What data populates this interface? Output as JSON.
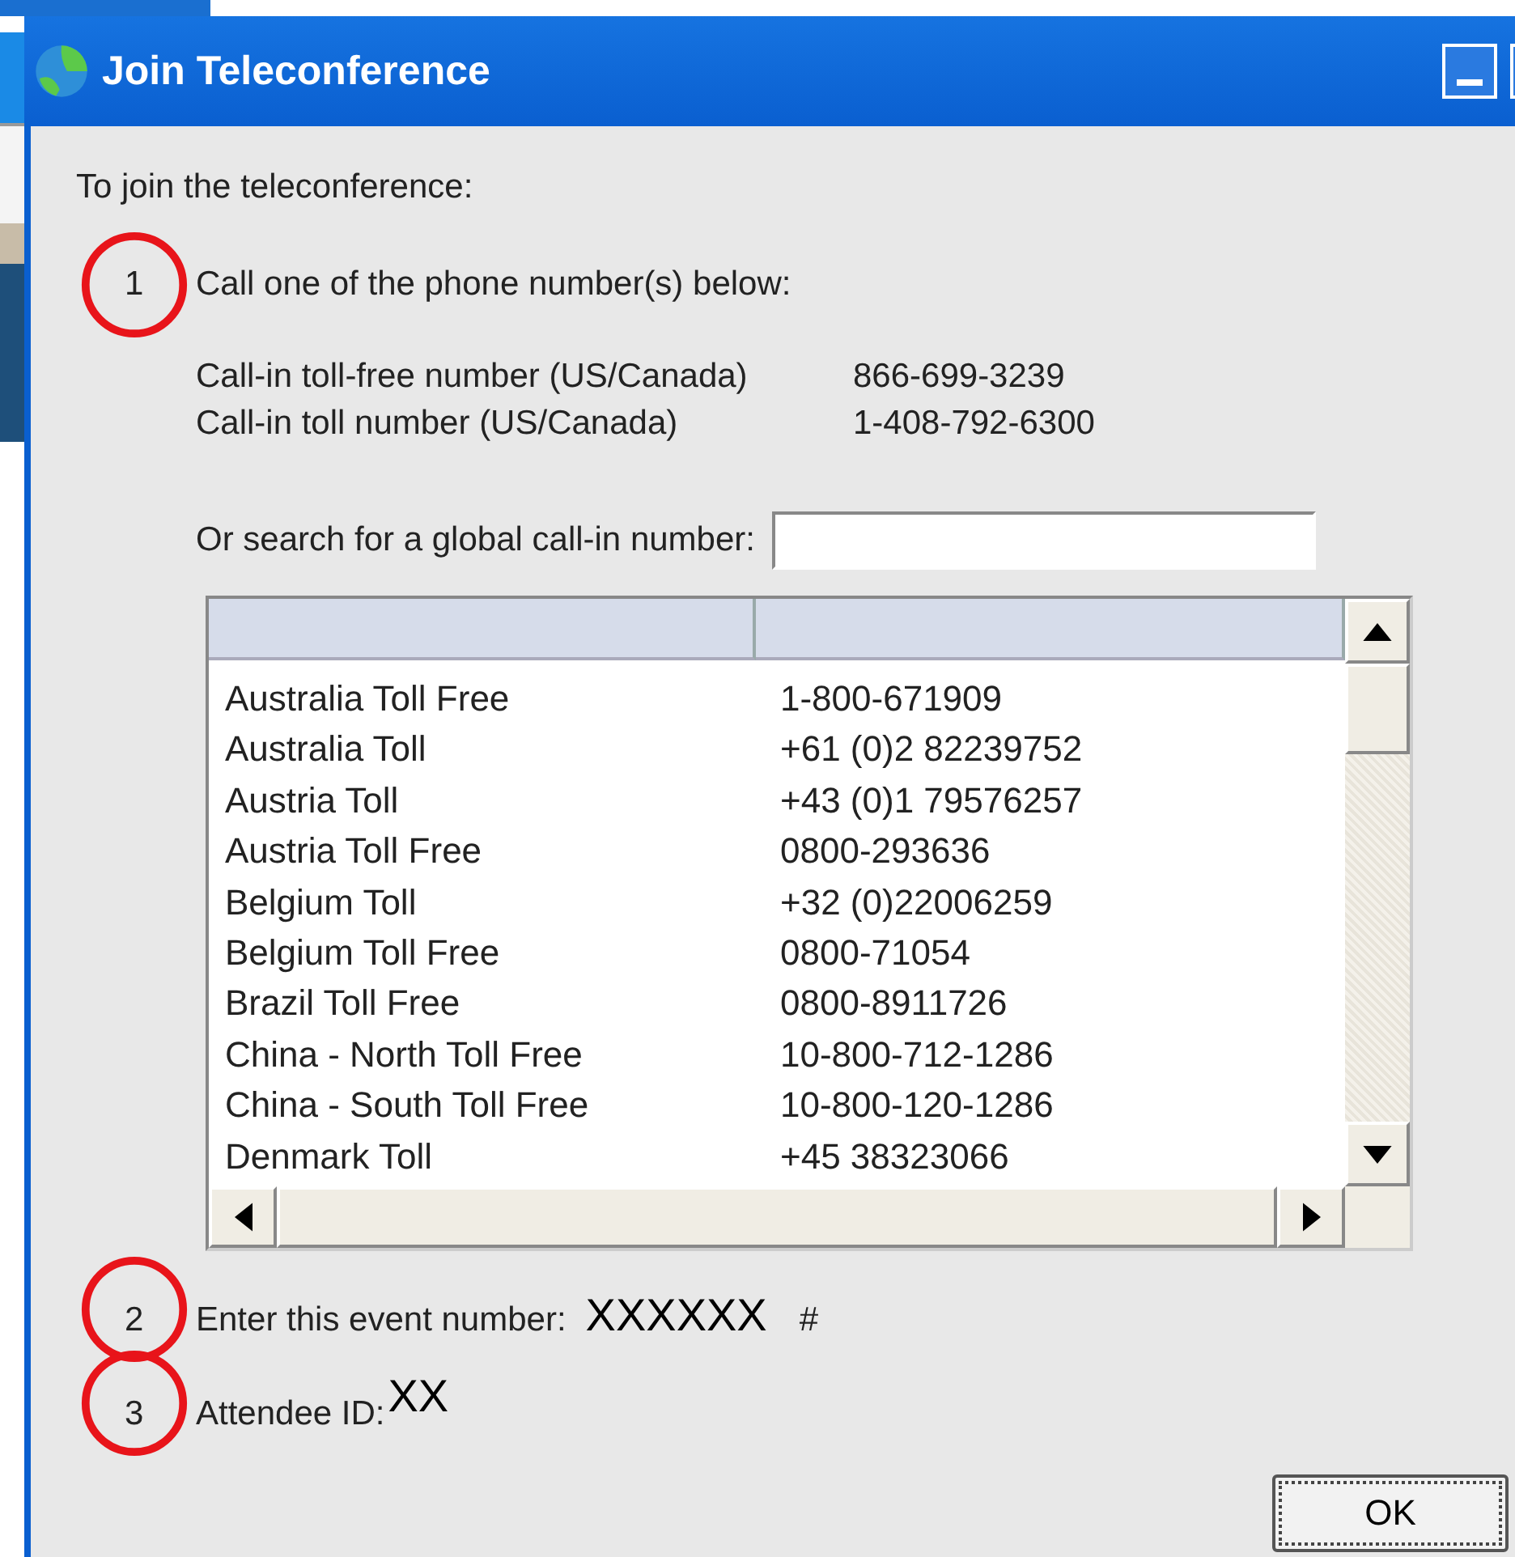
{
  "window": {
    "title": "Join Teleconference"
  },
  "intro": "To join the teleconference:",
  "steps": [
    {
      "kind": "call",
      "number": "1",
      "text": "Call one of the phone number(s) below:",
      "circled": true
    },
    {
      "kind": "event",
      "number": "2",
      "text": "Enter this event number:",
      "value": "XXXXXX",
      "suffix": "#",
      "circled": true
    },
    {
      "kind": "attendee",
      "number": "3",
      "text": "Attendee ID:",
      "value": "XX",
      "circled": true
    }
  ],
  "call_in_numbers": [
    {
      "label": "Call-in toll-free number (US/Canada)",
      "number": "866-699-3239"
    },
    {
      "label": "Call-in toll number (US/Canada)",
      "number": "1-408-792-6300"
    }
  ],
  "search": {
    "label": "Or search for a global call-in number:"
  },
  "table": {
    "rows": [
      {
        "country": "Australia Toll Free",
        "number": "1-800-671909"
      },
      {
        "country": "Australia Toll",
        "number": "+61 (0)2 82239752"
      },
      {
        "country": "Austria Toll",
        "number": "+43 (0)1 79576257"
      },
      {
        "country": "Austria Toll Free",
        "number": "0800-293636"
      },
      {
        "country": "Belgium Toll",
        "number": "+32 (0)22006259"
      },
      {
        "country": "Belgium Toll Free",
        "number": "0800-71054"
      },
      {
        "country": "Brazil Toll Free",
        "number": "0800-8911726"
      },
      {
        "country": "China - North Toll Free",
        "number": "10-800-712-1286"
      },
      {
        "country": "China - South Toll Free",
        "number": "10-800-120-1286"
      },
      {
        "country": "Denmark Toll",
        "number": "+45 38323066"
      }
    ]
  },
  "buttons": [
    "OK"
  ]
}
